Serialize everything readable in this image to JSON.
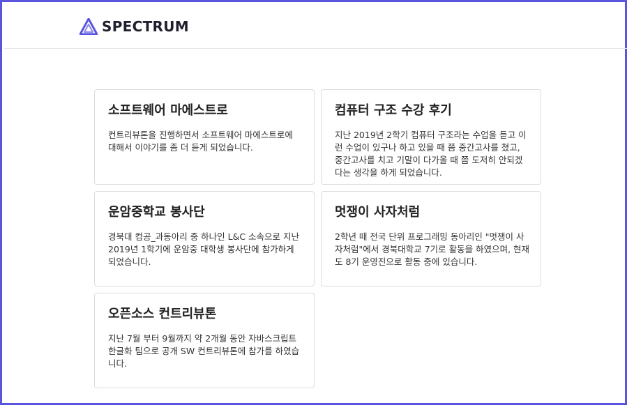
{
  "header": {
    "brand_name": "SPECTRUM",
    "logo_icon": "spectrum-triangle-logo",
    "accent_color": "#5a55de"
  },
  "cards": [
    {
      "title": "소프트웨어 마에스트로",
      "description": "컨트리뷰톤을 진행하면서 소프트웨어 마에스트로에 대해서 이야기를 좀 더 듣게 되었습니다."
    },
    {
      "title": "컴퓨터 구조 수강 후기",
      "description": "지난 2019년 2학기 컴퓨터 구조라는 수업을 듣고 이런 수업이 있구나 하고 있을 때 쯤 중간고사를 쳤고, 중간고사를 치고 기말이 다가올 때 쯤 도저히 안되겠다는 생각을 하게 되었습니다."
    },
    {
      "title": "운암중학교 봉사단",
      "description": "경북대 컴공_과동아리 중 하나인 L&C 소속으로 지난 2019년 1학기에 운암중 대학생 봉사단에 참가하게 되었습니다."
    },
    {
      "title": "멋쟁이 사자처럼",
      "description": "2학년 때 전국 단위 프로그래밍 동아리인 \"멋쟁이 사자처럼\"에서 경북대학교 7기로 활동을 하였으며, 현재도 8기 운영진으로 활동 중에 있습니다."
    },
    {
      "title": "오픈소스 컨트리뷰톤",
      "description": "지난 7월 부터 9월까지 약 2개월 동안 자바스크립트 한글화 팀으로 공개 SW 컨트리뷰톤에 참가를 하였습니다."
    }
  ]
}
